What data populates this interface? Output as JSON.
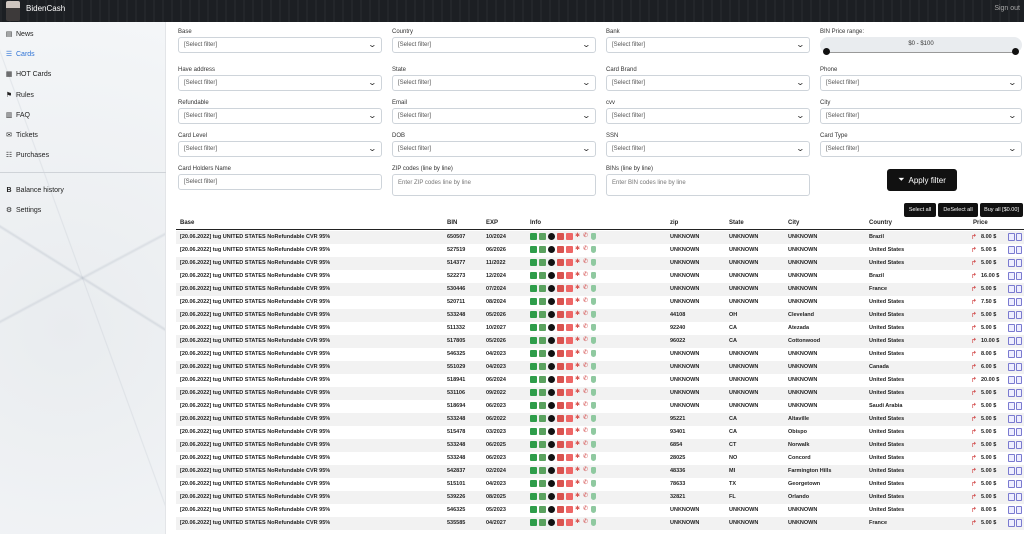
{
  "topbar": {
    "brand": "BidenCash",
    "signout": "Sign out"
  },
  "sidebar": {
    "items": [
      {
        "label": "News",
        "icon": "newspaper-icon",
        "glyph": "▤"
      },
      {
        "label": "Cards",
        "icon": "cards-icon",
        "glyph": "☰",
        "active": true
      },
      {
        "label": "HOT Cards",
        "icon": "hot-cards-icon",
        "glyph": "▦"
      },
      {
        "label": "Rules",
        "icon": "rules-icon",
        "glyph": "⚑"
      },
      {
        "label": "FAQ",
        "icon": "faq-icon",
        "glyph": "▥"
      },
      {
        "label": "Tickets",
        "icon": "tickets-icon",
        "glyph": "✉"
      },
      {
        "label": "Purchases",
        "icon": "purchases-icon",
        "glyph": "☷"
      }
    ],
    "items2": [
      {
        "label": "Balance history",
        "icon": "bitcoin-icon",
        "glyph": "B"
      },
      {
        "label": "Settings",
        "icon": "gear-icon",
        "glyph": "⚙"
      }
    ]
  },
  "filters": {
    "placeholder": "[Select filter]",
    "base": "Base",
    "country": "Country",
    "bank": "Bank",
    "bin_price": "BIN Price range:",
    "have_address": "Have address",
    "state": "State",
    "card_brand": "Card Brand",
    "phone": "Phone",
    "refundable": "Refundable",
    "email": "Email",
    "cvv": "cvv",
    "city": "City",
    "card_level": "Card Level",
    "dob": "DOB",
    "ssn": "SSN",
    "card_type": "Card Type",
    "holders_name": "Card Holders Name",
    "zip_codes": "ZIP codes (line by line)",
    "bins": "BINs (line by line)",
    "zip_placeholder": "Enter ZIP codes line by line",
    "bins_placeholder": "Enter BIN codes line by line",
    "price_range": "$0 - $100",
    "apply": "Apply filter"
  },
  "actions": {
    "select_all": "Select all",
    "deselect_all": "DeSelect all",
    "buy_all": "Buy all [$0.00]"
  },
  "table": {
    "headers": {
      "base": "Base",
      "bin": "BIN",
      "exp": "EXP",
      "info": "Info",
      "zip": "zip",
      "state": "State",
      "city": "City",
      "country": "Country",
      "price": "Price"
    },
    "rows": [
      {
        "base": "[20.06.2022] tug UNITED STATES NoRefundable CVR 95%",
        "bin": "650507",
        "exp": "10/2024",
        "zip": "UNKNOWN",
        "state": "UNKNOWN",
        "city": "UNKNOWN",
        "country": "Brazil",
        "price": "8.00 $"
      },
      {
        "base": "[20.06.2022] tug UNITED STATES NoRefundable CVR 95%",
        "bin": "527519",
        "exp": "06/2026",
        "zip": "UNKNOWN",
        "state": "UNKNOWN",
        "city": "UNKNOWN",
        "country": "United States",
        "price": "5.00 $"
      },
      {
        "base": "[20.06.2022] tug UNITED STATES NoRefundable CVR 95%",
        "bin": "514377",
        "exp": "11/2022",
        "zip": "UNKNOWN",
        "state": "UNKNOWN",
        "city": "UNKNOWN",
        "country": "United States",
        "price": "5.00 $"
      },
      {
        "base": "[20.06.2022] tug UNITED STATES NoRefundable CVR 95%",
        "bin": "522273",
        "exp": "12/2024",
        "zip": "UNKNOWN",
        "state": "UNKNOWN",
        "city": "UNKNOWN",
        "country": "Brazil",
        "price": "16.00 $"
      },
      {
        "base": "[20.06.2022] tug UNITED STATES NoRefundable CVR 95%",
        "bin": "530446",
        "exp": "07/2024",
        "zip": "UNKNOWN",
        "state": "UNKNOWN",
        "city": "UNKNOWN",
        "country": "France",
        "price": "5.00 $"
      },
      {
        "base": "[20.06.2022] tug UNITED STATES NoRefundable CVR 95%",
        "bin": "520711",
        "exp": "08/2024",
        "zip": "UNKNOWN",
        "state": "UNKNOWN",
        "city": "UNKNOWN",
        "country": "United States",
        "price": "7.50 $"
      },
      {
        "base": "[20.06.2022] tug UNITED STATES NoRefundable CVR 95%",
        "bin": "533248",
        "exp": "05/2026",
        "zip": "44108",
        "state": "OH",
        "city": "Cleveland",
        "country": "United States",
        "price": "5.00 $"
      },
      {
        "base": "[20.06.2022] tug UNITED STATES NoRefundable CVR 95%",
        "bin": "511332",
        "exp": "10/2027",
        "zip": "92240",
        "state": "CA",
        "city": "Atezada",
        "country": "United States",
        "price": "5.00 $"
      },
      {
        "base": "[20.06.2022] tug UNITED STATES NoRefundable CVR 95%",
        "bin": "517805",
        "exp": "05/2026",
        "zip": "96022",
        "state": "CA",
        "city": "Cottonwood",
        "country": "United States",
        "price": "10.00 $"
      },
      {
        "base": "[20.06.2022] tug UNITED STATES NoRefundable CVR 95%",
        "bin": "546325",
        "exp": "04/2023",
        "zip": "UNKNOWN",
        "state": "UNKNOWN",
        "city": "UNKNOWN",
        "country": "United States",
        "price": "8.00 $"
      },
      {
        "base": "[20.06.2022] tug UNITED STATES NoRefundable CVR 95%",
        "bin": "551029",
        "exp": "04/2023",
        "zip": "UNKNOWN",
        "state": "UNKNOWN",
        "city": "UNKNOWN",
        "country": "Canada",
        "price": "6.00 $"
      },
      {
        "base": "[20.06.2022] tug UNITED STATES NoRefundable CVR 95%",
        "bin": "518941",
        "exp": "06/2024",
        "zip": "UNKNOWN",
        "state": "UNKNOWN",
        "city": "UNKNOWN",
        "country": "United States",
        "price": "20.00 $"
      },
      {
        "base": "[20.06.2022] tug UNITED STATES NoRefundable CVR 95%",
        "bin": "531106",
        "exp": "09/2022",
        "zip": "UNKNOWN",
        "state": "UNKNOWN",
        "city": "UNKNOWN",
        "country": "United States",
        "price": "5.00 $"
      },
      {
        "base": "[20.06.2022] tug UNITED STATES NoRefundable CVR 95%",
        "bin": "518694",
        "exp": "06/2023",
        "zip": "UNKNOWN",
        "state": "UNKNOWN",
        "city": "UNKNOWN",
        "country": "Saudi Arabia",
        "price": "5.00 $"
      },
      {
        "base": "[20.06.2022] tug UNITED STATES NoRefundable CVR 95%",
        "bin": "533248",
        "exp": "06/2022",
        "zip": "95221",
        "state": "CA",
        "city": "Altaville",
        "country": "United States",
        "price": "5.00 $"
      },
      {
        "base": "[20.06.2022] tug UNITED STATES NoRefundable CVR 95%",
        "bin": "515478",
        "exp": "03/2023",
        "zip": "93401",
        "state": "CA",
        "city": "Obispo",
        "country": "United States",
        "price": "5.00 $"
      },
      {
        "base": "[20.06.2022] tug UNITED STATES NoRefundable CVR 95%",
        "bin": "533248",
        "exp": "06/2025",
        "zip": "6854",
        "state": "CT",
        "city": "Norwalk",
        "country": "United States",
        "price": "5.00 $"
      },
      {
        "base": "[20.06.2022] tug UNITED STATES NoRefundable CVR 95%",
        "bin": "533248",
        "exp": "06/2023",
        "zip": "28025",
        "state": "NO",
        "city": "Concord",
        "country": "United States",
        "price": "5.00 $"
      },
      {
        "base": "[20.06.2022] tug UNITED STATES NoRefundable CVR 95%",
        "bin": "542837",
        "exp": "02/2024",
        "zip": "48336",
        "state": "MI",
        "city": "Farmington Hills",
        "country": "United States",
        "price": "5.00 $"
      },
      {
        "base": "[20.06.2022] tug UNITED STATES NoRefundable CVR 95%",
        "bin": "515101",
        "exp": "04/2023",
        "zip": "78633",
        "state": "TX",
        "city": "Georgetown",
        "country": "United States",
        "price": "5.00 $"
      },
      {
        "base": "[20.06.2022] tug UNITED STATES NoRefundable CVR 95%",
        "bin": "539226",
        "exp": "08/2025",
        "zip": "32821",
        "state": "FL",
        "city": "Orlando",
        "country": "United States",
        "price": "5.00 $"
      },
      {
        "base": "[20.06.2022] tug UNITED STATES NoRefundable CVR 95%",
        "bin": "546325",
        "exp": "05/2023",
        "zip": "UNKNOWN",
        "state": "UNKNOWN",
        "city": "UNKNOWN",
        "country": "United States",
        "price": "8.00 $"
      },
      {
        "base": "[20.06.2022] tug UNITED STATES NoRefundable CVR 95%",
        "bin": "535585",
        "exp": "04/2027",
        "zip": "UNKNOWN",
        "state": "UNKNOWN",
        "city": "UNKNOWN",
        "country": "France",
        "price": "5.00 $"
      }
    ]
  }
}
